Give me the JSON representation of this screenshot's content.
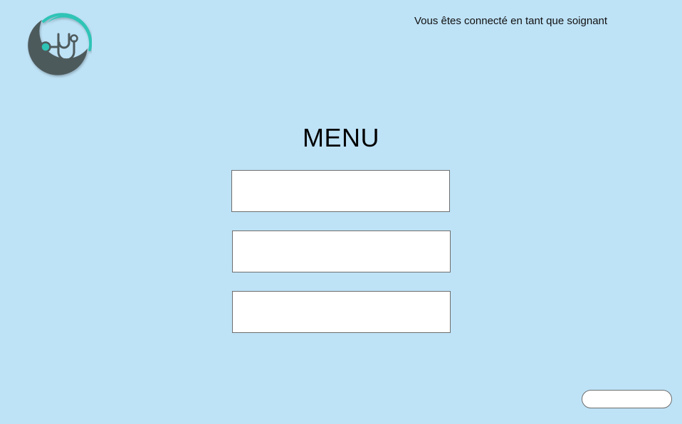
{
  "header": {
    "logo_icon": "stethoscope-icon",
    "status_text": "Vous êtes connecté en tant que soignant"
  },
  "menu": {
    "title": "MENU",
    "buttons": [
      {
        "label": ""
      },
      {
        "label": ""
      },
      {
        "label": ""
      }
    ]
  },
  "footer": {
    "pill_button_label": ""
  },
  "colors": {
    "background": "#bee2f6",
    "logo_teal": "#2ec4b6",
    "logo_gray": "#4d5a5c"
  }
}
